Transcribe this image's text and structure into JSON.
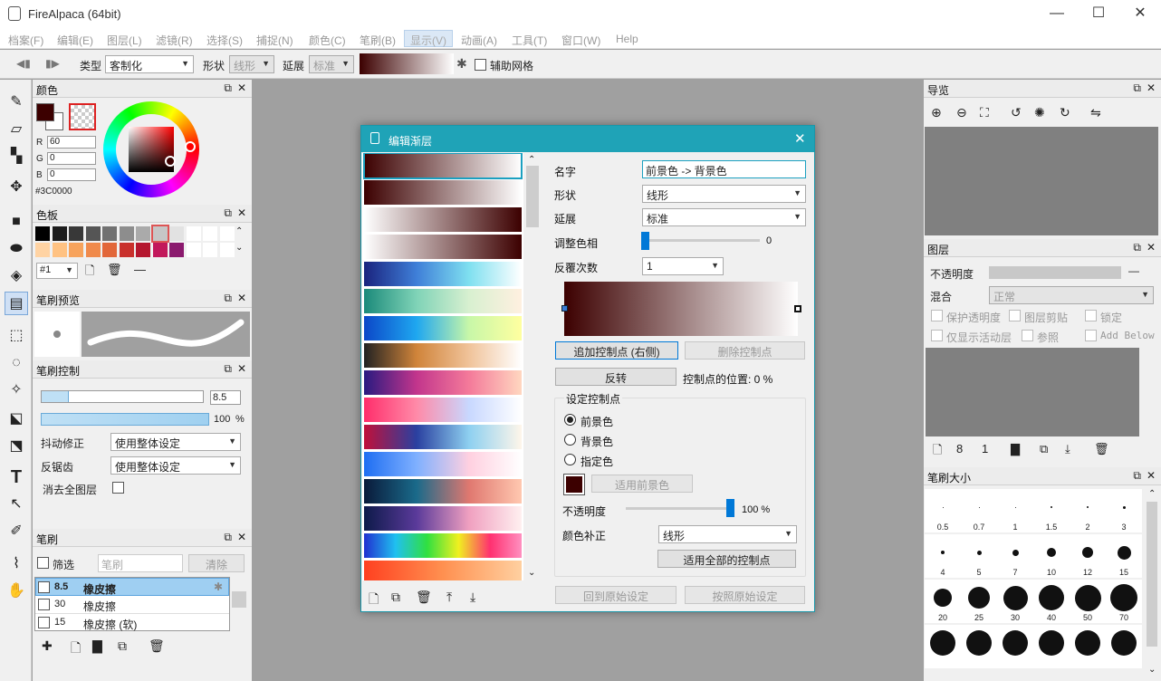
{
  "window": {
    "title": "FireAlpaca (64bit)",
    "minimize": "—",
    "maximize": "☐",
    "close": "✕"
  },
  "menu": [
    "档案(F)",
    "编辑(E)",
    "图层(L)",
    "滤镜(R)",
    "选择(S)",
    "捕捉(N)",
    "颜色(C)",
    "笔刷(B)",
    "显示(V)",
    "动画(A)",
    "工具(T)",
    "窗口(W)",
    "Help"
  ],
  "toolbar": {
    "type_label": "类型",
    "type_value": "客制化",
    "shape_label": "形状",
    "shape_value": "线形",
    "extend_label": "延展",
    "extend_value": "标准",
    "aux_grid": "辅助网格"
  },
  "color_panel": {
    "title": "颜色",
    "r_label": "R",
    "r": "60",
    "g_label": "G",
    "g": "0",
    "b_label": "B",
    "b": "0",
    "hex": "#3C0000",
    "fg_color": "#3c0000"
  },
  "palette_panel": {
    "title": "色板",
    "palette_id": "#1",
    "row1": [
      "#000000",
      "#1c1c1c",
      "#383838",
      "#555555",
      "#717171",
      "#8d8d8d",
      "#aaaaaa",
      "#c6c6c6",
      "#e2e2e2",
      "#ffffff",
      "#ffffff",
      "#ffffff"
    ],
    "row2": [
      "#ffd3a3",
      "#ffc282",
      "#f7a35c",
      "#f08a4b",
      "#e2673a",
      "#c9302c",
      "#b5172f",
      "#c2185b",
      "#8b1a6e",
      "#ffffff",
      "#ffffff",
      "#ffffff"
    ]
  },
  "brush_preview": {
    "title": "笔刷预览"
  },
  "brush_control": {
    "title": "笔刷控制",
    "size": "8.5",
    "opacity": "100",
    "opacity_unit": "%",
    "stabilizer_label": "抖动修正",
    "stabilizer_value": "使用整体设定",
    "aa_label": "反锯齿",
    "aa_value": "使用整体设定",
    "erase_all_label": "消去全图层"
  },
  "brush_panel": {
    "title": "笔刷",
    "filter_label": "筛选",
    "filter_placeholder": "笔刷",
    "clear_label": "清除",
    "items": [
      {
        "size": "8.5",
        "name": "橡皮擦"
      },
      {
        "size": "30",
        "name": "橡皮擦"
      },
      {
        "size": "15",
        "name": "橡皮擦 (软)"
      }
    ]
  },
  "nav_panel": {
    "title": "导览"
  },
  "layer_panel": {
    "title": "图层",
    "opacity_label": "不透明度",
    "blend_label": "混合",
    "blend_value": "正常",
    "opt1": "保护透明度",
    "opt2": "图层剪贴",
    "opt3": "锁定",
    "opt4": "仅显示活动层",
    "opt5": "参照",
    "opt6": "Add Below"
  },
  "brush_size_panel": {
    "title": "笔刷大小",
    "sizes": [
      {
        "label": "0.5",
        "d": 1
      },
      {
        "label": "0.7",
        "d": 1
      },
      {
        "label": "1",
        "d": 1
      },
      {
        "label": "1.5",
        "d": 2
      },
      {
        "label": "2",
        "d": 2
      },
      {
        "label": "3",
        "d": 3
      },
      {
        "label": "4",
        "d": 4
      },
      {
        "label": "5",
        "d": 5
      },
      {
        "label": "7",
        "d": 7
      },
      {
        "label": "10",
        "d": 10
      },
      {
        "label": "12",
        "d": 12
      },
      {
        "label": "15",
        "d": 15
      },
      {
        "label": "20",
        "d": 20
      },
      {
        "label": "25",
        "d": 24
      },
      {
        "label": "30",
        "d": 27
      },
      {
        "label": "40",
        "d": 28
      },
      {
        "label": "50",
        "d": 29
      },
      {
        "label": "70",
        "d": 30
      },
      {
        "label": "",
        "d": 28
      },
      {
        "label": "",
        "d": 28
      },
      {
        "label": "",
        "d": 28
      },
      {
        "label": "",
        "d": 28
      },
      {
        "label": "",
        "d": 28
      },
      {
        "label": "",
        "d": 28
      }
    ]
  },
  "dialog": {
    "title": "编辑渐层",
    "name_label": "名字",
    "name_value": "前景色 -> 背景色",
    "shape_label": "形状",
    "shape_value": "线形",
    "extend_label": "延展",
    "extend_value": "标准",
    "hue_label": "调整色相",
    "hue_value": "0",
    "repeat_label": "反覆次数",
    "repeat_value": "1",
    "add_point": "追加控制点 (右侧)",
    "delete_point": "删除控制点",
    "reverse": "反转",
    "point_pos_label": "控制点的位置: 0 %",
    "set_point_title": "设定控制点",
    "radio_fg": "前景色",
    "radio_bg": "背景色",
    "radio_custom": "指定色",
    "apply_fg": "适用前景色",
    "opacity_label": "不透明度",
    "opacity_value": "100 %",
    "color_correct_label": "颜色补正",
    "color_correct_value": "线形",
    "apply_all": "适用全部的控制点",
    "reset_original": "回到原始设定",
    "set_original": "按照原始设定",
    "gradients": [
      "linear-gradient(90deg,#3c0000,#ffffff)",
      "linear-gradient(90deg,#3c0000,#ffffff)",
      "linear-gradient(90deg,#ffffff,#3c0000)",
      "linear-gradient(90deg,#ffffff,#3c0000)",
      "linear-gradient(90deg,#1a237e,#3f7fd8,#7fe0f0,#ffffff)",
      "linear-gradient(90deg,#1b8a7a,#7fd3b7,#d8f0d0,#fff0e0)",
      "linear-gradient(90deg,#0b47c8,#1fa7f0,#c8f7a8,#ffffa0)",
      "linear-gradient(90deg,#222222,#d0843a,#f0c39a,#ffffff)",
      "linear-gradient(90deg,#2a1a80,#c2358c,#f47a9a,#ffd7c0)",
      "linear-gradient(90deg,#ff2e6b,#ff8aa8,#c8d8ff,#ffffff)",
      "linear-gradient(90deg,#c0103a,#2a40a0,#8ed0f0,#fff6ea)",
      "linear-gradient(90deg,#1e6ef2,#7fb0ff,#ffd0e0,#ffffff)",
      "linear-gradient(90deg,#0a1a3a,#1a6a8a,#e07870,#ffc8b0)",
      "linear-gradient(90deg,#0d1a4a,#5a3a9a,#f0a0c0,#fff0f0)",
      "linear-gradient(90deg,#2030d0,#20c0f0,#30e040,#f0f020,#ff3070,#ff90c0)",
      "linear-gradient(90deg,#ff4020,#ff9050,#ffd0a0)"
    ]
  }
}
